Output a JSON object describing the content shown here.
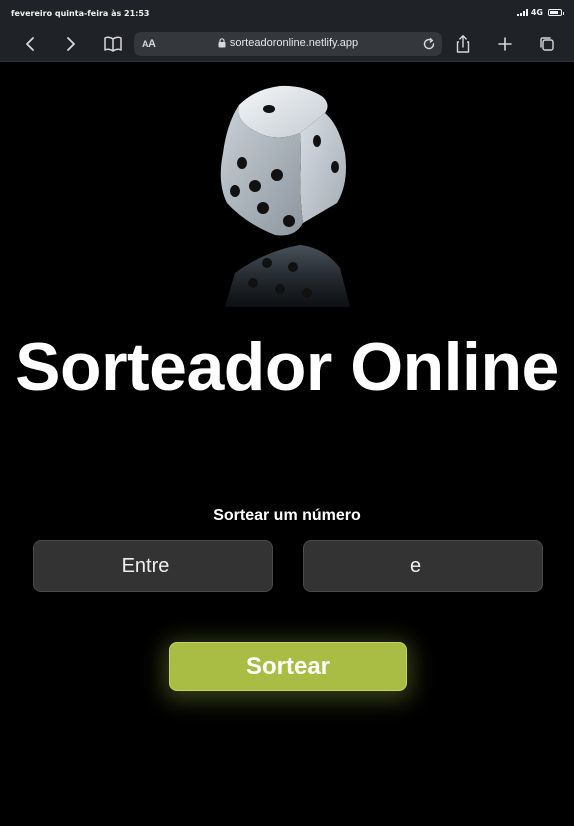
{
  "status_bar": {
    "time": "fevereiro quinta-feira às 21:53",
    "network": "4G",
    "battery_level": 0.8
  },
  "browser": {
    "text_size_label_small": "A",
    "text_size_label_large": "A",
    "url": "sorteadoronline.netlify.app",
    "icons": [
      "back-icon",
      "forward-icon",
      "bookmarks-icon",
      "lock-icon",
      "reload-icon",
      "share-icon",
      "new-tab-icon",
      "tabs-icon"
    ]
  },
  "page": {
    "title": "Sorteador Online",
    "section_label": "Sortear um número",
    "input_min_placeholder": "Entre",
    "input_max_placeholder": "e",
    "draw_button_label": "Sortear",
    "accent_color": "#a9bd45"
  }
}
